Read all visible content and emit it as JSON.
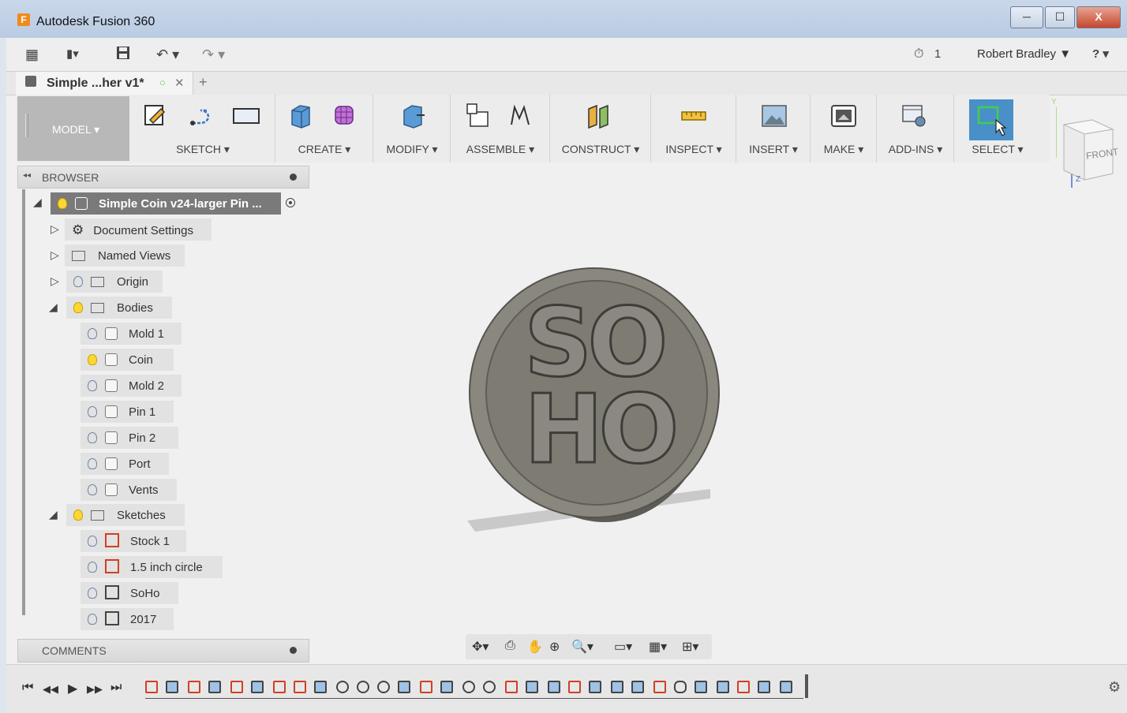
{
  "window": {
    "title": "Autodesk Fusion 360",
    "app_icon": "F",
    "minimize": "─",
    "maximize": "☐",
    "close": "X"
  },
  "quick_access": {
    "grid_icon": "▦",
    "file_icon": "▮▾",
    "save_icon": "💾",
    "undo_icon": "↶ ▾",
    "redo_icon": "↷ ▾",
    "job_status": "1",
    "clock_icon": "⏱",
    "user": "Robert Bradley ▼",
    "help_icon": "? ▾"
  },
  "document_tab": {
    "label": "Simple ...her v1*",
    "circle": "○",
    "close": "✕",
    "new_tab": "+"
  },
  "ribbon": {
    "workspace": "MODEL ▾",
    "groups": [
      {
        "label": "SKETCH ▾"
      },
      {
        "label": "CREATE ▾"
      },
      {
        "label": "MODIFY ▾"
      },
      {
        "label": "ASSEMBLE ▾"
      },
      {
        "label": "CONSTRUCT ▾"
      },
      {
        "label": "INSPECT ▾"
      },
      {
        "label": "INSERT ▾"
      },
      {
        "label": "MAKE ▾"
      },
      {
        "label": "ADD-INS ▾"
      },
      {
        "label": "SELECT ▾"
      }
    ],
    "accent": "#4a90c8"
  },
  "view_cube": {
    "face": "FRONT",
    "axis_y": "Y",
    "axis_z": "Z"
  },
  "browser": {
    "header": "BROWSER",
    "collapse": "◂◂",
    "root": "Simple Coin v24-larger Pin ...",
    "nodes": [
      {
        "label": "Document Settings",
        "icon": "gear-icon"
      },
      {
        "label": "Named Views",
        "icon": "folder-icon"
      },
      {
        "label": "Origin",
        "icon": "folder-icon"
      },
      {
        "label": "Bodies",
        "icon": "folder-icon"
      },
      {
        "label": "Mold 1",
        "icon": "body-icon"
      },
      {
        "label": "Coin",
        "icon": "body-icon"
      },
      {
        "label": "Mold 2",
        "icon": "body-icon"
      },
      {
        "label": "Pin 1",
        "icon": "body-icon"
      },
      {
        "label": "Pin 2",
        "icon": "body-icon"
      },
      {
        "label": "Port",
        "icon": "body-icon"
      },
      {
        "label": "Vents",
        "icon": "body-icon"
      },
      {
        "label": "Sketches",
        "icon": "folder-icon"
      },
      {
        "label": "Stock 1",
        "icon": "sketch-icon"
      },
      {
        "label": "1.5 inch circle",
        "icon": "sketch-icon"
      },
      {
        "label": "SoHo",
        "icon": "sketch-icon"
      },
      {
        "label": "2017",
        "icon": "sketch-icon"
      }
    ]
  },
  "comments": {
    "label": "COMMENTS"
  },
  "canvas": {
    "coin_text_top": "SO",
    "coin_text_bottom": "HO"
  },
  "timeline": {
    "first": "⏮",
    "prev": "◀◀",
    "play": "▶",
    "next": "▶▶",
    "last": "⏭",
    "settings": "⚙"
  }
}
